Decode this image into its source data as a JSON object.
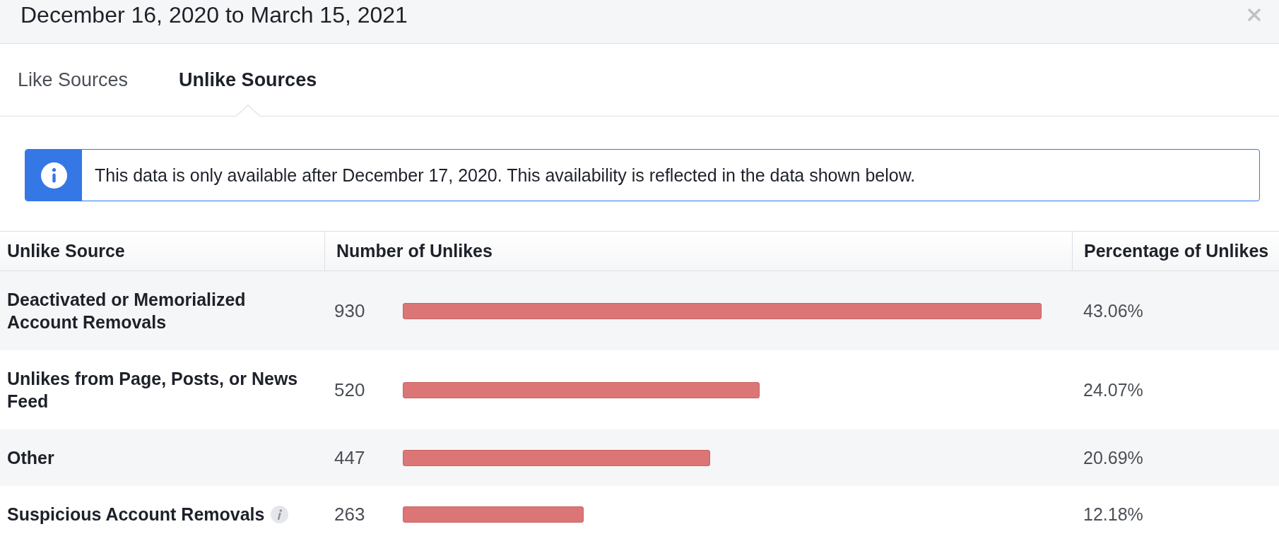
{
  "header": {
    "title": "December 16, 2020 to March 15, 2021"
  },
  "tabs": [
    {
      "label": "Like Sources",
      "selected": false
    },
    {
      "label": "Unlike Sources",
      "selected": true
    }
  ],
  "notice": {
    "text": "This data is only available after December 17, 2020. This availability is reflected in the data shown below."
  },
  "table": {
    "columns": [
      "Unlike Source",
      "Number of Unlikes",
      "Percentage of Unlikes"
    ],
    "rows": [
      {
        "source": "Deactivated or Memorialized Account Removals",
        "count": "930",
        "percentage": "43.06%",
        "has_info": false
      },
      {
        "source": "Unlikes from Page, Posts, or News Feed",
        "count": "520",
        "percentage": "24.07%",
        "has_info": false
      },
      {
        "source": "Other",
        "count": "447",
        "percentage": "20.69%",
        "has_info": false
      },
      {
        "source": "Suspicious Account Removals",
        "count": "263",
        "percentage": "12.18%",
        "has_info": true
      }
    ]
  }
}
